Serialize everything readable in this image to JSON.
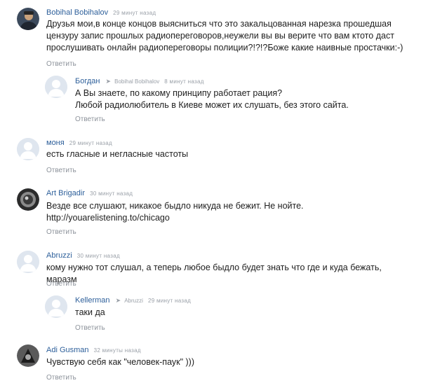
{
  "reply_label": "Ответить",
  "comments": [
    {
      "author": "Bobihal Bobihalov",
      "time": "29 минут назад",
      "text": "Друзья мои,в конце концов выясниться что это закальцованная нарезка прошедшая\nцензуру запис прошлых радиопереговоров,неужели вы вы верите что вам ктото даст\nпрослушивать онлайн радиопереговоры полиции?!?!?Боже какие наивные простачки:-)",
      "avatar": "photo-avatar"
    },
    {
      "author": "Богдан",
      "reply_to": "Bobihal Bobihalov",
      "time": "8 минут назад",
      "text": "А Вы знаете, по какому принципу работает рация?\nЛюбой радиолюбитель в Киеве может их слушать, без этого сайта.",
      "avatar": "default-avatar"
    },
    {
      "author": "моня",
      "time": "29 минут назад",
      "text": "есть гласные и негласные частоты",
      "avatar": "default-avatar"
    },
    {
      "author": "Art Brigadir",
      "time": "30 минут назад",
      "text": "Везде все слушают, никакое быдло никуда не бежит. Не нойте.\nhttp://youarelistening.to/chicago",
      "avatar": "photo-avatar"
    },
    {
      "author": "Abruzzi",
      "time": "30 минут назад",
      "text": "кому нужно тот слушал, а теперь любое быдло будет знать что где и куда бежать, маразм",
      "avatar": "default-avatar"
    },
    {
      "author": "Kellerman",
      "reply_to": "Abruzzi",
      "time": "29 минут назад",
      "text": "таки да",
      "avatar": "default-avatar"
    },
    {
      "author": "Adi Gusman",
      "time": "32 минуты назад",
      "text": "Чувствую себя как \"человек-паук\" )))",
      "avatar": "photo-avatar"
    }
  ]
}
